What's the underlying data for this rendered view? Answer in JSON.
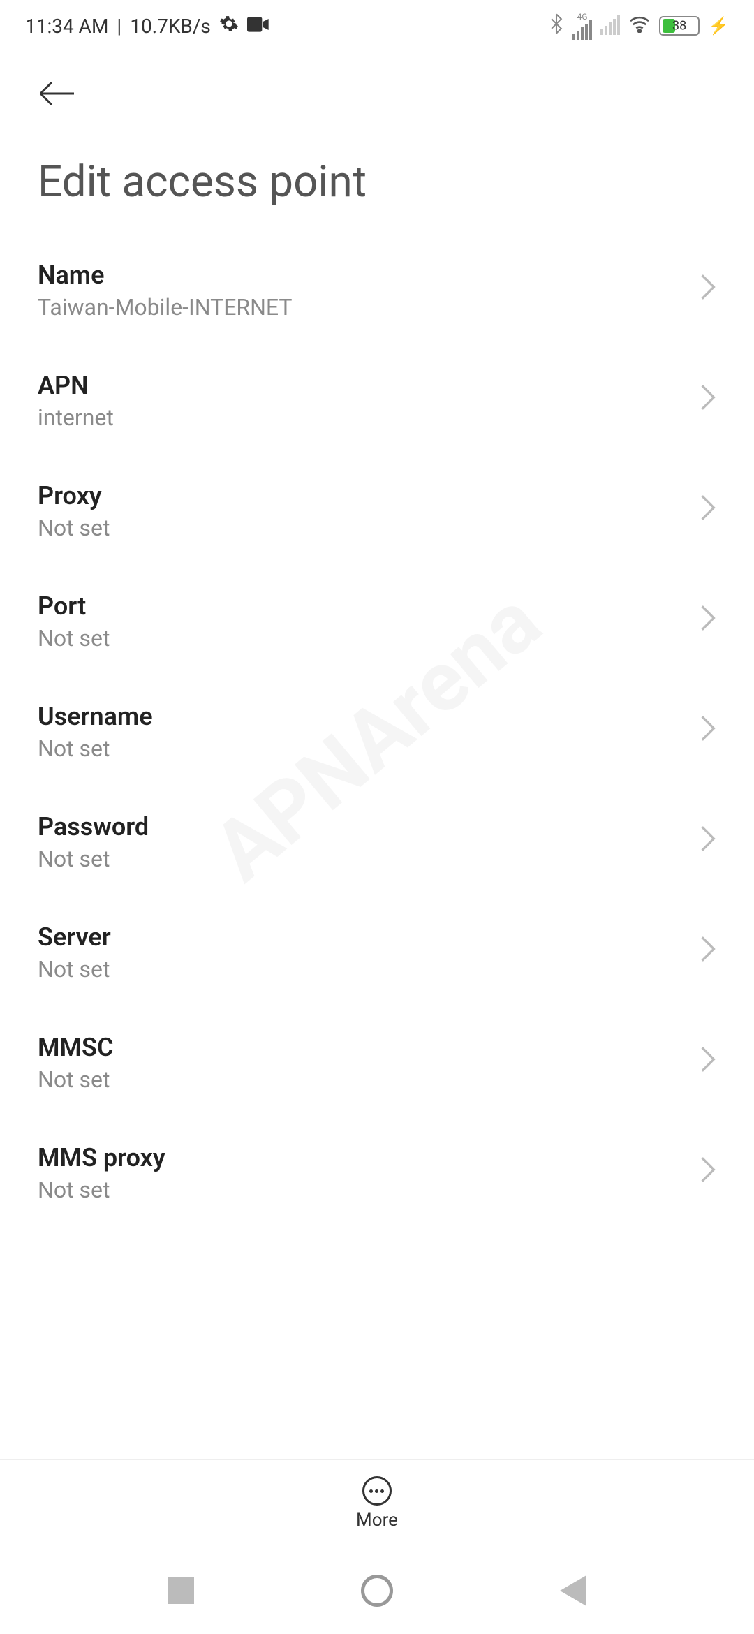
{
  "status_bar": {
    "time": "11:34 AM",
    "data_rate": "10.7KB/s",
    "network_label": "4G",
    "battery_percent": "38"
  },
  "header": {
    "title": "Edit access point"
  },
  "items": [
    {
      "label": "Name",
      "value": "Taiwan-Mobile-INTERNET"
    },
    {
      "label": "APN",
      "value": "internet"
    },
    {
      "label": "Proxy",
      "value": "Not set"
    },
    {
      "label": "Port",
      "value": "Not set"
    },
    {
      "label": "Username",
      "value": "Not set"
    },
    {
      "label": "Password",
      "value": "Not set"
    },
    {
      "label": "Server",
      "value": "Not set"
    },
    {
      "label": "MMSC",
      "value": "Not set"
    },
    {
      "label": "MMS proxy",
      "value": "Not set"
    }
  ],
  "toolbar": {
    "more_label": "More"
  },
  "watermark": "APNArena"
}
